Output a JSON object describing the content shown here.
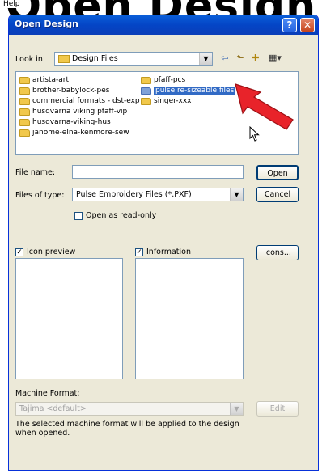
{
  "background": {
    "heading": "Open Design",
    "menu_help": "Help"
  },
  "window": {
    "title": "Open Design",
    "help_btn": "?",
    "close_btn": "✕"
  },
  "look_in": {
    "label": "Look in:",
    "value": "Design Files"
  },
  "toolbar": {
    "back_icon": "back-arrow-icon",
    "up_icon": "up-folder-icon",
    "new_folder_icon": "new-folder-icon",
    "view_icon": "view-menu-icon"
  },
  "folders": [
    {
      "name": "artista-art"
    },
    {
      "name": "brother-babylock-pes"
    },
    {
      "name": "commercial formats - dst-exp"
    },
    {
      "name": "husqvarna viking pfaff-vip"
    },
    {
      "name": "husqvarna-viking-hus"
    },
    {
      "name": "janome-elna-kenmore-sew"
    },
    {
      "name": "pfaff-pcs"
    },
    {
      "name": "pulse re-sizeable files",
      "selected": true
    },
    {
      "name": "singer-xxx"
    }
  ],
  "file_name": {
    "label": "File name:",
    "value": ""
  },
  "files_of_type": {
    "label": "Files of type:",
    "value": "Pulse Embroidery Files (*.PXF)"
  },
  "open_readonly": {
    "label": "Open as read-only",
    "checked": false
  },
  "buttons": {
    "open": "Open",
    "cancel": "Cancel",
    "icons": "Icons...",
    "edit": "Edit"
  },
  "icon_preview": {
    "label": "Icon preview",
    "checked": true
  },
  "information": {
    "label": "Information",
    "checked": true
  },
  "machine_format": {
    "label": "Machine Format:",
    "value": "Tajima <default>",
    "note": "The selected machine format will be applied to the design when opened."
  },
  "colors": {
    "title_blue": "#0a5ed8",
    "selection": "#316ac5",
    "dialog_bg": "#ece9d8",
    "annotation_arrow": "#e8232a"
  }
}
